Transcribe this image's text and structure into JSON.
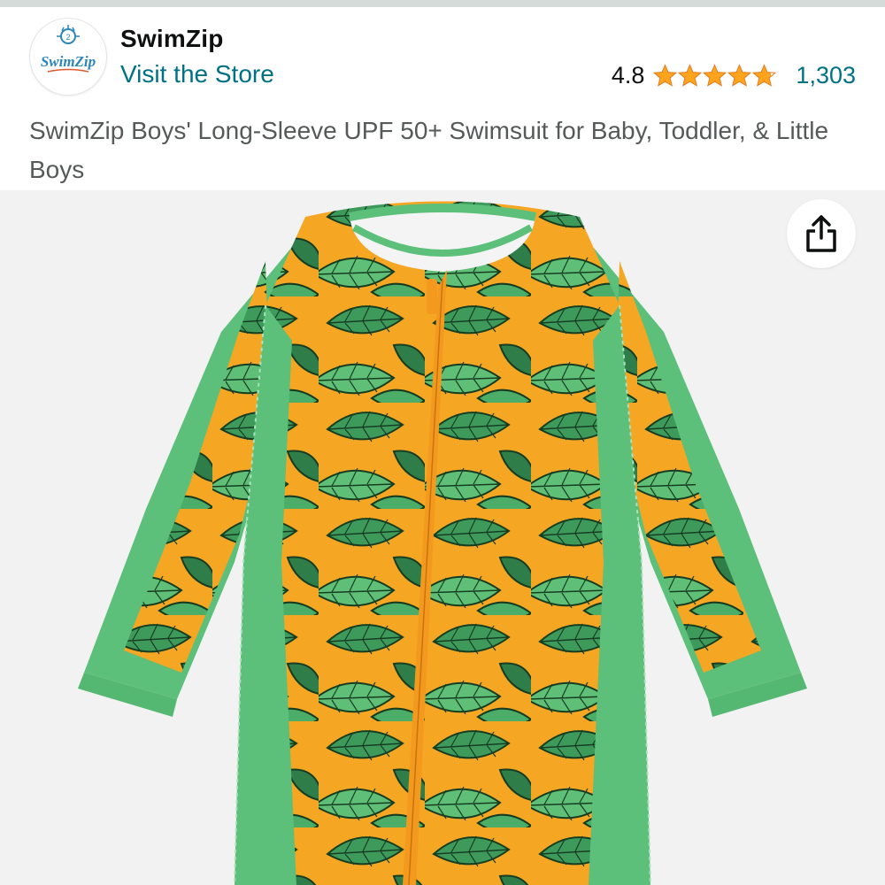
{
  "store": {
    "logo_text": "SwimZip",
    "name": "SwimZip",
    "visit_label": "Visit the Store"
  },
  "rating": {
    "value": "4.8",
    "stars": 4.8,
    "max_stars": 5,
    "review_count": "1,303"
  },
  "product": {
    "title": "SwimZip Boys' Long-Sleeve UPF 50+ Swimsuit for Baby, Toddler, & Little Boys"
  },
  "icons": {
    "share": "share-icon",
    "star": "star-icon"
  },
  "colors": {
    "link": "#007185",
    "star": "#FFA41C",
    "suit_green": "#5cbf7a",
    "suit_orange": "#f5a623",
    "zipper": "#f39a1e"
  }
}
